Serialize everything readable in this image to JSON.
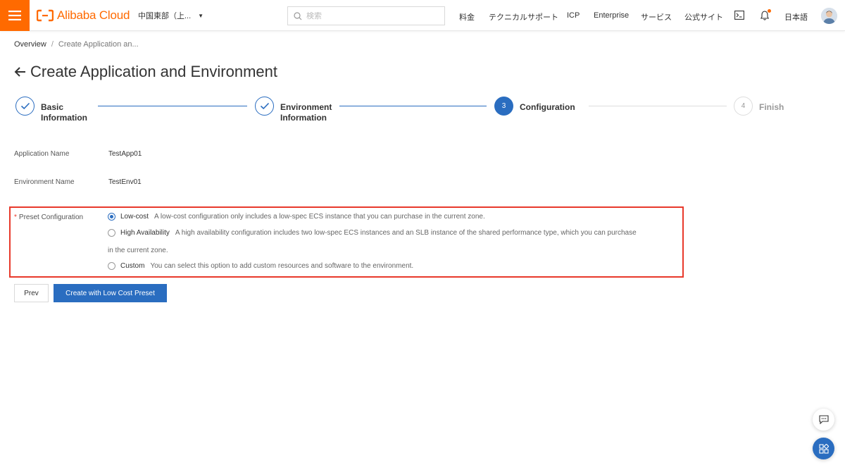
{
  "header": {
    "brand": "Alibaba Cloud",
    "region": "中国東部（上...",
    "search_placeholder": "検索",
    "nav": [
      "料金",
      "テクニカルサポート",
      "ICP",
      "Enterprise",
      "サービス",
      "公式サイト"
    ],
    "language": "日本語"
  },
  "breadcrumb": {
    "root": "Overview",
    "separator": "/",
    "current": "Create Application an..."
  },
  "page": {
    "title": "Create Application and Environment"
  },
  "steps": [
    {
      "number": "1",
      "label_line1": "Basic",
      "label_line2": "Information",
      "status": "done"
    },
    {
      "number": "2",
      "label_line1": "Environment",
      "label_line2": "Information",
      "status": "done"
    },
    {
      "number": "3",
      "label_line1": "Configuration",
      "label_line2": "",
      "status": "current"
    },
    {
      "number": "4",
      "label_line1": "Finish",
      "label_line2": "",
      "status": "todo"
    }
  ],
  "form": {
    "app_name_label": "Application Name",
    "app_name_value": "TestApp01",
    "env_name_label": "Environment Name",
    "env_name_value": "TestEnv01",
    "preset_required_mark": "*",
    "preset_label": "Preset Configuration",
    "options": [
      {
        "name": "Low-cost",
        "description": "A low-cost configuration only includes a low-spec ECS instance that you can purchase in the current zone.",
        "checked": true
      },
      {
        "name": "High Availability",
        "description": "A high availability configuration includes two low-spec ECS instances and an SLB instance of the shared performance type, which you can purchase",
        "description_cont": "in the current zone.",
        "checked": false
      },
      {
        "name": "Custom",
        "description": "You can select this option to add custom resources and software to the environment.",
        "checked": false
      }
    ]
  },
  "actions": {
    "prev": "Prev",
    "create": "Create with Low Cost Preset"
  },
  "colors": {
    "brand_orange": "#ff6a00",
    "primary_blue": "#2a6dc0",
    "highlight_red": "#e8392b"
  },
  "icons": {
    "menu": "hamburger-icon",
    "search": "search-icon",
    "terminal": "terminal-icon",
    "bell": "bell-icon",
    "back": "arrow-left-icon",
    "check": "check-icon",
    "chat": "chat-icon",
    "apps": "apps-icon"
  }
}
